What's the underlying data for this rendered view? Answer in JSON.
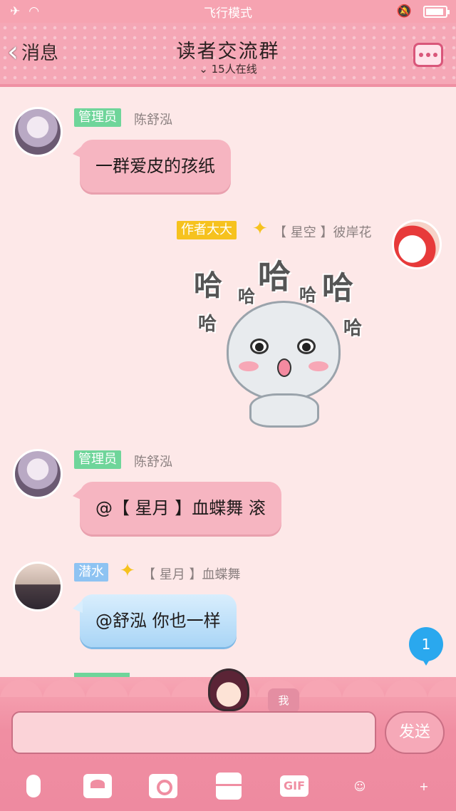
{
  "status_bar": {
    "mode": "飞行模式"
  },
  "header": {
    "back_label": "消息",
    "title": "读者交流群",
    "online": "15人在线"
  },
  "messages": [
    {
      "side": "left",
      "tag": "管理员",
      "name": "陈舒泓",
      "text": "一群爱皮的孩纸",
      "avatar": "anime-girl-avatar"
    },
    {
      "side": "right",
      "tag": "作者大大",
      "name": "【 星空 】彼岸花",
      "sticker": {
        "repeated_text": "哈",
        "image": "laughing-cat-sticker"
      },
      "avatar": "red-umbrella-avatar"
    },
    {
      "side": "left",
      "tag": "管理员",
      "name": "陈舒泓",
      "text": "@【 星月 】血蝶舞 滚",
      "avatar": "anime-girl-avatar"
    },
    {
      "side": "left",
      "tag": "潜水",
      "name": "【 星月 】血蝶舞",
      "text": "@舒泓 你也一样",
      "avatar": "photo-girl-avatar"
    }
  ],
  "unread_badge": "1",
  "composer": {
    "me_label": "我",
    "send_label": "发送",
    "gif_label": "GIF"
  },
  "colors": {
    "header_bg": "#f5a7b6",
    "chat_bg": "#fde8e8",
    "admin_tag": "#6fd59a",
    "author_tag": "#f6c21e",
    "diver_tag": "#8ec3f2",
    "pink_bubble": "#f6b5c1",
    "badge": "#2aa8ee"
  }
}
